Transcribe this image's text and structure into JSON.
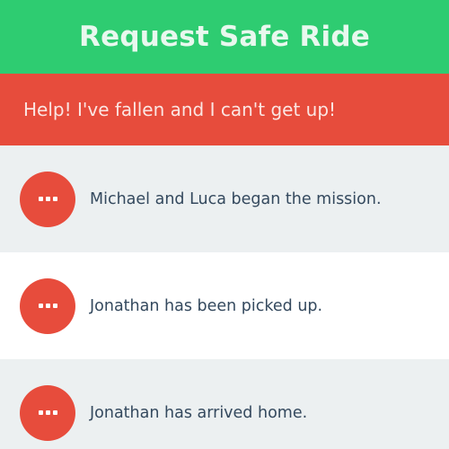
{
  "header": {
    "title": "Request Safe Ride"
  },
  "alert": {
    "message": "Help! I've fallen and I can't get up!"
  },
  "status_items": [
    {
      "text": "Michael and Luca began the mission.",
      "icon": "ellipsis-icon"
    },
    {
      "text": "Jonathan has been picked up.",
      "icon": "ellipsis-icon"
    },
    {
      "text": "Jonathan has arrived home.",
      "icon": "ellipsis-icon"
    }
  ],
  "colors": {
    "header_green": "#2ecc71",
    "alert_red": "#e74c3c",
    "row_gray": "#ecf0f1",
    "text_dark": "#34495e"
  }
}
